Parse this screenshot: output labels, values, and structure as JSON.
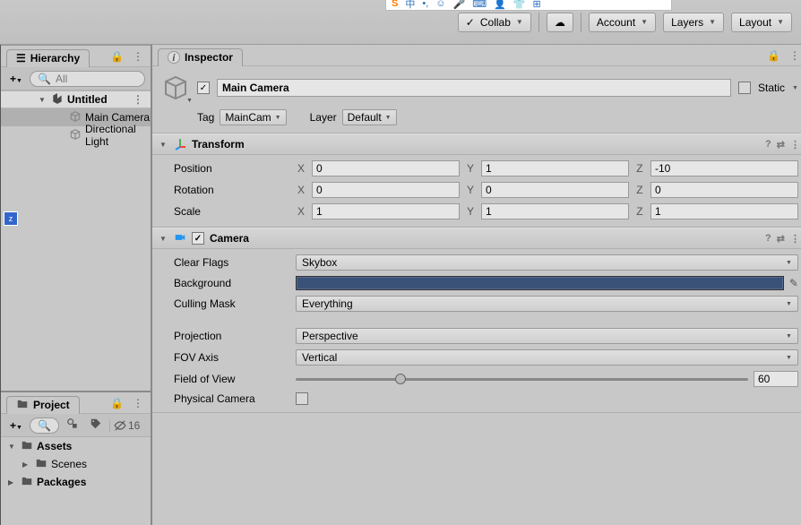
{
  "toolbar": {
    "collab": "Collab",
    "account": "Account",
    "layers": "Layers",
    "layout": "Layout"
  },
  "hierarchy": {
    "title": "Hierarchy",
    "search_placeholder": "All",
    "scene": "Untitled",
    "items": [
      "Main Camera",
      "Directional Light"
    ]
  },
  "project": {
    "title": "Project",
    "hidden_count": "16",
    "roots": [
      "Assets",
      "Packages"
    ],
    "assets_children": [
      "Scenes"
    ]
  },
  "inspector": {
    "title": "Inspector",
    "object_name": "Main Camera",
    "static_label": "Static",
    "tag_label": "Tag",
    "tag_value": "MainCam",
    "layer_label": "Layer",
    "layer_value": "Default",
    "transform": {
      "title": "Transform",
      "position_label": "Position",
      "rotation_label": "Rotation",
      "scale_label": "Scale",
      "position": {
        "x": "0",
        "y": "1",
        "z": "-10"
      },
      "rotation": {
        "x": "0",
        "y": "0",
        "z": "0"
      },
      "scale": {
        "x": "1",
        "y": "1",
        "z": "1"
      }
    },
    "camera": {
      "title": "Camera",
      "clear_flags_label": "Clear Flags",
      "clear_flags": "Skybox",
      "background_label": "Background",
      "background_color": "#3a5278",
      "culling_mask_label": "Culling Mask",
      "culling_mask": "Everything",
      "projection_label": "Projection",
      "projection": "Perspective",
      "fov_axis_label": "FOV Axis",
      "fov_axis": "Vertical",
      "fov_label": "Field of View",
      "fov": "60",
      "physical_label": "Physical Camera"
    }
  }
}
